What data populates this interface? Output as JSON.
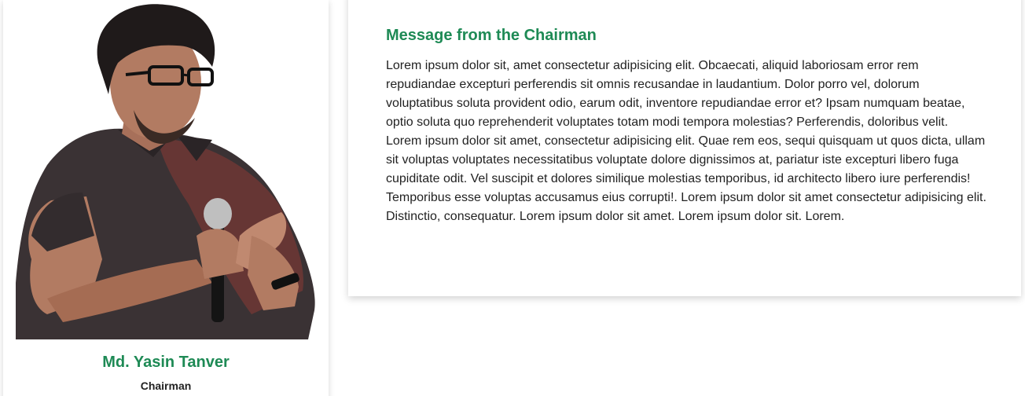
{
  "profile": {
    "name": "Md. Yasin Tanver",
    "role": "Chairman",
    "photo_alt": "chairman-photo"
  },
  "message": {
    "title": "Message from the Chairman",
    "body": "Lorem ipsum dolor sit, amet consectetur adipisicing elit. Obcaecati, aliquid laboriosam error rem repudiandae excepturi perferendis sit omnis recusandae in laudantium. Dolor porro vel, dolorum voluptatibus soluta provident odio, earum odit, inventore repudiandae error et? Ipsam numquam beatae, optio soluta quo reprehenderit voluptates totam modi tempora molestias? Perferendis, doloribus velit. Lorem ipsum dolor sit amet, consectetur adipisicing elit. Quae rem eos, sequi quisquam ut quos dicta, ullam sit voluptas voluptates necessitatibus voluptate dolore dignissimos at, pariatur iste excepturi libero fuga cupiditate odit. Vel suscipit et dolores similique molestias temporibus, id architecto libero iure perferendis! Temporibus esse voluptas accusamus eius corrupti!. Lorem ipsum dolor sit amet consectetur adipisicing elit. Distinctio, consequatur. Lorem ipsum dolor sit amet. Lorem ipsum dolor sit. Lorem."
  },
  "colors": {
    "accent_green": "#1e8a55",
    "text_dark": "#222222"
  }
}
